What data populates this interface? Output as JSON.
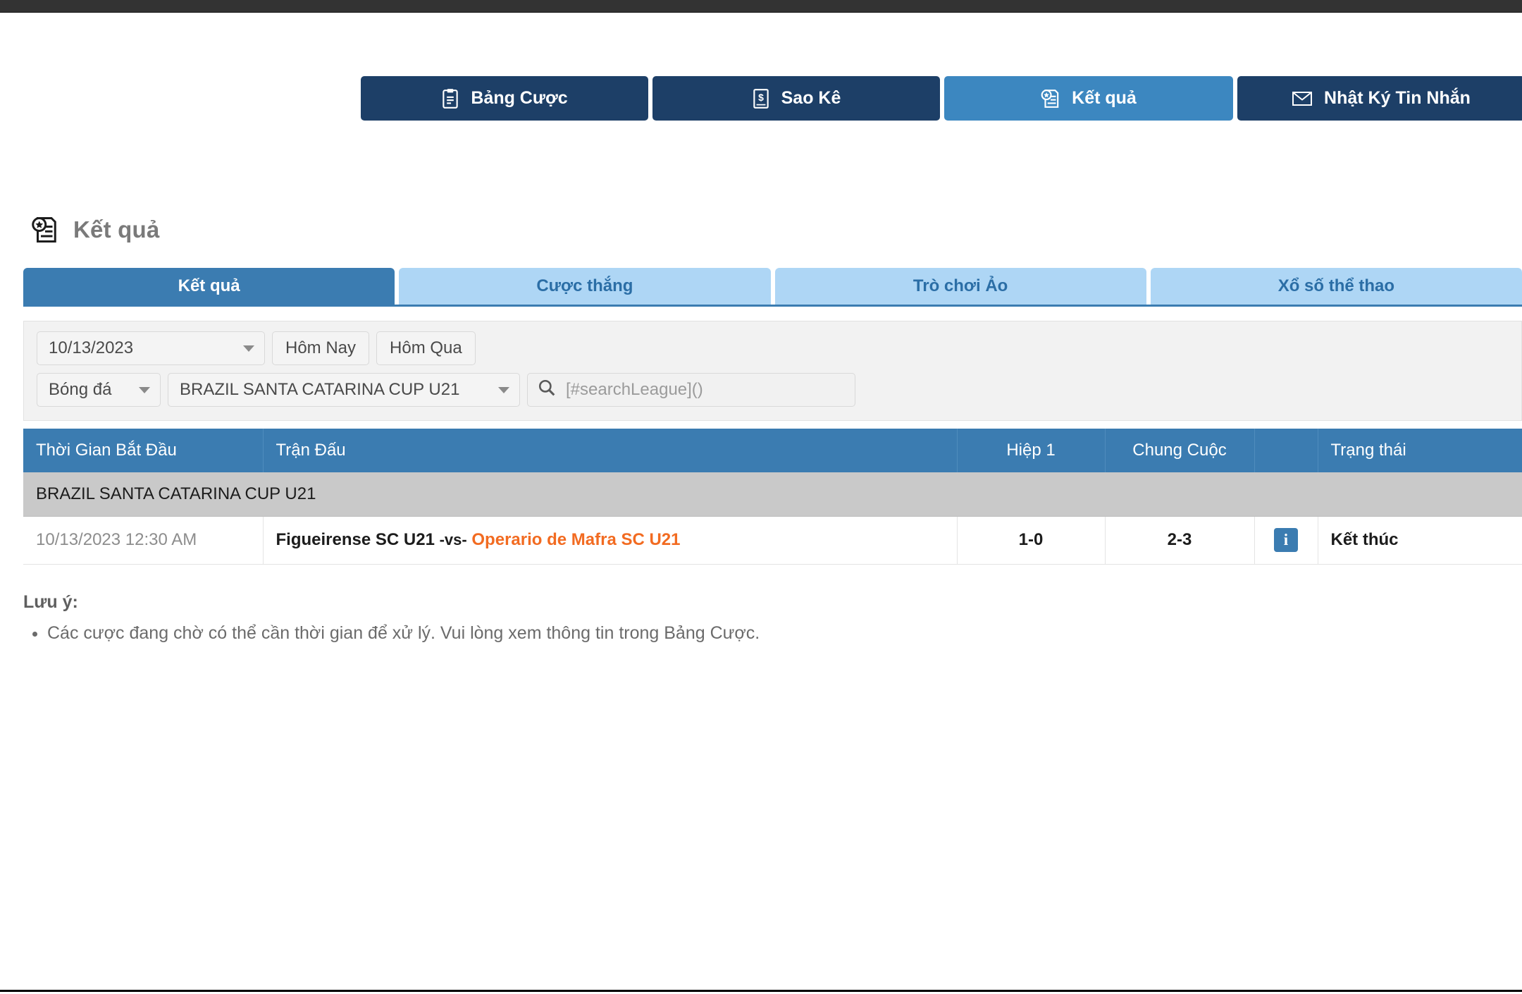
{
  "top_nav": {
    "buttons": [
      {
        "label": "Bảng Cược",
        "icon": "clipboard-icon",
        "active": false
      },
      {
        "label": "Sao Kê",
        "icon": "statement-icon",
        "active": false
      },
      {
        "label": "Kết quả",
        "icon": "results-icon",
        "active": true
      },
      {
        "label": "Nhật Ký Tin Nhắn",
        "icon": "envelope-icon",
        "active": false
      }
    ]
  },
  "page": {
    "title": "Kết quả",
    "title_icon": "results-icon"
  },
  "tabs": [
    {
      "label": "Kết quả",
      "active": true
    },
    {
      "label": "Cược thắng",
      "active": false
    },
    {
      "label": "Trò chơi Ảo",
      "active": false
    },
    {
      "label": "Xổ số thể thao",
      "active": false
    }
  ],
  "filters": {
    "date_value": "10/13/2023",
    "today_label": "Hôm Nay",
    "yesterday_label": "Hôm Qua",
    "sport_value": "Bóng đá",
    "league_value": "BRAZIL SANTA CATARINA CUP U21",
    "search_placeholder": "[#searchLeague]()",
    "search_value": "",
    "search_icon": "search-icon"
  },
  "table": {
    "headers": {
      "time": "Thời Gian Bắt Đầu",
      "match": "Trận Đấu",
      "half1": "Hiệp 1",
      "fulltime": "Chung Cuộc",
      "info": "",
      "status": "Trạng thái"
    },
    "league_group": "BRAZIL SANTA CATARINA CUP U21",
    "rows": [
      {
        "time": "10/13/2023 12:30 AM",
        "home_team": "Figueirense SC U21",
        "separator": "-vs-",
        "away_team": "Operario de Mafra SC U21",
        "half1": "1-0",
        "fulltime": "2-3",
        "info_icon": "info-icon",
        "status": "Kết thúc"
      }
    ]
  },
  "note": {
    "title": "Lưu ý:",
    "items": [
      "Các cược đang chờ có thể cần thời gian để xử lý. Vui lòng xem thông tin trong Bảng Cược."
    ]
  },
  "colors": {
    "nav_dark": "#1d3f67",
    "nav_active": "#3c87c0",
    "tab_active": "#3b7cb1",
    "tab_inactive": "#aed6f5",
    "table_header": "#3b7cb1",
    "league_row": "#c9c9c9",
    "away_team": "#f26b21",
    "top_strip": "#333333"
  }
}
